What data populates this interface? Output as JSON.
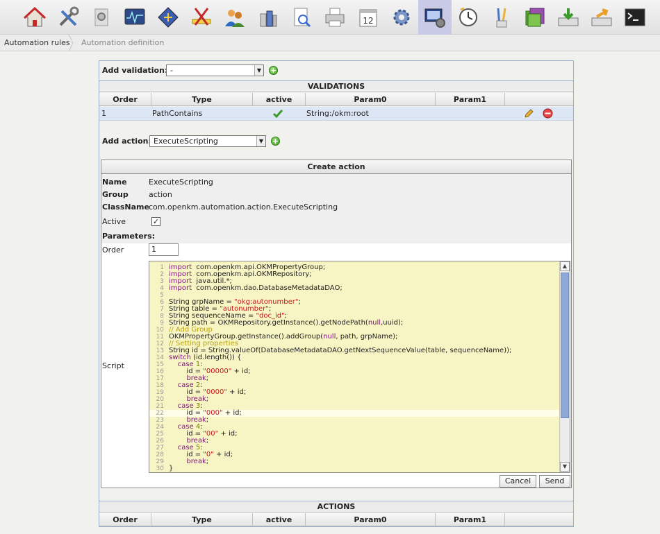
{
  "toolbar": {
    "icons": [
      "home-icon",
      "tools-icon",
      "search-icon",
      "monitor-icon",
      "diamond-icon",
      "scissors-icon",
      "users-icon",
      "database-icon",
      "report-icon",
      "printer-icon",
      "calendar-icon",
      "gear-icon",
      "automation-icon",
      "clock-icon",
      "brushes-icon",
      "folders-icon",
      "import-icon",
      "export-icon",
      "terminal-icon"
    ],
    "calendar_day": "12",
    "active_index": 12
  },
  "breadcrumb": {
    "item1": "Automation rules",
    "item2": "Automation definition"
  },
  "validation": {
    "add_label": "Add validation:",
    "selected": "-",
    "section_title": "VALIDATIONS",
    "columns": [
      "Order",
      "Type",
      "active",
      "Param0",
      "Param1"
    ],
    "rows": [
      {
        "order": "1",
        "type": "PathContains",
        "param0": "String:/okm:root",
        "param1": ""
      }
    ]
  },
  "action": {
    "add_label": "Add action:",
    "selected": "ExecuteScripting",
    "create_title": "Create action",
    "name_label": "Name",
    "name_value": "ExecuteScripting",
    "group_label": "Group",
    "group_value": "action",
    "classname_label": "ClassName",
    "classname_value": "com.openkm.automation.action.ExecuteScripting",
    "active_label": "Active",
    "active_check": "✓",
    "parameters_label": "Parameters:",
    "order_label": "Order",
    "order_value": "1",
    "script_label": "Script",
    "cancel": "Cancel",
    "send": "Send"
  },
  "script_lines": [
    {
      "n": "1",
      "parts": [
        [
          "kw",
          "import"
        ],
        [
          "",
          "  com.openkm.api.OKMPropertyGroup;"
        ]
      ]
    },
    {
      "n": "2",
      "parts": [
        [
          "kw",
          "import"
        ],
        [
          "",
          "  com.openkm.api.OKMRepository;"
        ]
      ]
    },
    {
      "n": "3",
      "parts": [
        [
          "kw",
          "import"
        ],
        [
          "",
          "  java.util.*;"
        ]
      ]
    },
    {
      "n": "4",
      "parts": [
        [
          "kw",
          "import"
        ],
        [
          "",
          "  com.openkm.dao.DatabaseMetadataDAO;"
        ]
      ]
    },
    {
      "n": "5",
      "parts": [
        [
          "",
          ""
        ]
      ]
    },
    {
      "n": "6",
      "parts": [
        [
          "",
          "String grpName = "
        ],
        [
          "str",
          "\"okg:autonumber\""
        ],
        [
          "",
          ";"
        ]
      ]
    },
    {
      "n": "7",
      "parts": [
        [
          "",
          "String table = "
        ],
        [
          "str",
          "\"autonumber\""
        ],
        [
          "",
          ";"
        ]
      ]
    },
    {
      "n": "8",
      "parts": [
        [
          "",
          "String sequenceName = "
        ],
        [
          "str",
          "\"doc_id\""
        ],
        [
          "",
          ";"
        ]
      ]
    },
    {
      "n": "9",
      "parts": [
        [
          "",
          "String path = OKMRepository.getInstance().getNodePath("
        ],
        [
          "kw",
          "null"
        ],
        [
          "",
          ",uuid);"
        ]
      ]
    },
    {
      "n": "10",
      "parts": [
        [
          "cm",
          "// Add Group"
        ]
      ]
    },
    {
      "n": "11",
      "parts": [
        [
          "",
          "OKMPropertyGroup.getInstance().addGroup("
        ],
        [
          "kw",
          "null"
        ],
        [
          "",
          ", path, grpName);"
        ]
      ]
    },
    {
      "n": "12",
      "parts": [
        [
          "cm",
          "// Setting properties"
        ]
      ]
    },
    {
      "n": "13",
      "parts": [
        [
          "",
          "String id = String.valueOf(DatabaseMetadataDAO.getNextSequenceValue(table, sequenceName));"
        ]
      ]
    },
    {
      "n": "14",
      "parts": [
        [
          "kw",
          "switch"
        ],
        [
          "",
          ""
        ],
        [
          "",
          " (id.length()) {"
        ]
      ]
    },
    {
      "n": "15",
      "parts": [
        [
          "",
          "    "
        ],
        [
          "kw",
          "case"
        ],
        [
          "num",
          " 1"
        ],
        [
          "",
          ":"
        ]
      ]
    },
    {
      "n": "16",
      "parts": [
        [
          "",
          "        id = "
        ],
        [
          "str",
          "\"00000\""
        ],
        [
          "",
          " + id;"
        ]
      ]
    },
    {
      "n": "17",
      "parts": [
        [
          "",
          "        "
        ],
        [
          "kw",
          "break"
        ],
        [
          "",
          ";"
        ]
      ]
    },
    {
      "n": "18",
      "parts": [
        [
          "",
          "    "
        ],
        [
          "kw",
          "case"
        ],
        [
          "num",
          " 2"
        ],
        [
          "",
          ":"
        ]
      ]
    },
    {
      "n": "19",
      "parts": [
        [
          "",
          "        id = "
        ],
        [
          "str",
          "\"0000\""
        ],
        [
          "",
          " + id;"
        ]
      ]
    },
    {
      "n": "20",
      "parts": [
        [
          "",
          "        "
        ],
        [
          "kw",
          "break"
        ],
        [
          "",
          ";"
        ]
      ]
    },
    {
      "n": "21",
      "parts": [
        [
          "",
          "    "
        ],
        [
          "kw",
          "case"
        ],
        [
          "num",
          " 3"
        ],
        [
          "",
          ":"
        ]
      ]
    },
    {
      "n": "22",
      "parts": [
        [
          "",
          "        id = "
        ],
        [
          "str",
          "\"000\""
        ],
        [
          "",
          " + id;"
        ]
      ]
    },
    {
      "n": "23",
      "parts": [
        [
          "",
          "        "
        ],
        [
          "kw",
          "break"
        ],
        [
          "",
          ";"
        ]
      ]
    },
    {
      "n": "24",
      "parts": [
        [
          "",
          "    "
        ],
        [
          "kw",
          "case"
        ],
        [
          "num",
          " 4"
        ],
        [
          "",
          ":"
        ]
      ]
    },
    {
      "n": "25",
      "parts": [
        [
          "",
          "        id = "
        ],
        [
          "str",
          "\"00\""
        ],
        [
          "",
          " + id;"
        ]
      ]
    },
    {
      "n": "26",
      "parts": [
        [
          "",
          "        "
        ],
        [
          "kw",
          "break"
        ],
        [
          "",
          ";"
        ]
      ]
    },
    {
      "n": "27",
      "parts": [
        [
          "",
          "    "
        ],
        [
          "kw",
          "case"
        ],
        [
          "num",
          " 5"
        ],
        [
          "",
          ":"
        ]
      ]
    },
    {
      "n": "28",
      "parts": [
        [
          "",
          "        id = "
        ],
        [
          "str",
          "\"0\""
        ],
        [
          "",
          " + id;"
        ]
      ]
    },
    {
      "n": "29",
      "parts": [
        [
          "",
          "        "
        ],
        [
          "kw",
          "break"
        ],
        [
          "",
          ";"
        ]
      ]
    },
    {
      "n": "30",
      "parts": [
        [
          "",
          "}"
        ]
      ]
    }
  ],
  "actions_table": {
    "section_title": "ACTIONS",
    "columns": [
      "Order",
      "Type",
      "active",
      "Param0",
      "Param1"
    ]
  }
}
